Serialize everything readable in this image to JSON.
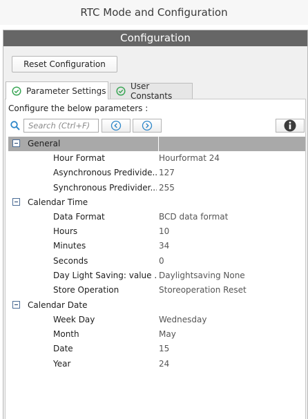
{
  "window": {
    "title": "RTC Mode and Configuration"
  },
  "panel": {
    "header": "Configuration"
  },
  "reset_button": {
    "label": "Reset Configuration"
  },
  "tabs": [
    {
      "label": "Parameter Settings",
      "active": true
    },
    {
      "label": "User Constants",
      "active": false
    }
  ],
  "configure_label": "Configure the below parameters :",
  "search": {
    "placeholder": "Search (Ctrl+F)",
    "value": ""
  },
  "icons": {
    "search": "search-icon",
    "prev": "arrow-left-icon",
    "next": "arrow-right-icon",
    "info": "info-icon",
    "tab_check": "check-circle-icon",
    "collapse": "collapse-icon"
  },
  "colors": {
    "panel_header": "#666666",
    "selected_row": "#a9a9a9",
    "check_green": "#3aa655",
    "nav_blue": "#2c86c9"
  },
  "groups": [
    {
      "label": "General",
      "selected": true,
      "params": [
        {
          "name": "Hour Format",
          "value": "Hourformat 24"
        },
        {
          "name": "Asynchronous Predivide...",
          "value": "127"
        },
        {
          "name": "Synchronous Predivider...",
          "value": "255"
        }
      ]
    },
    {
      "label": "Calendar Time",
      "selected": false,
      "params": [
        {
          "name": "Data Format",
          "value": "BCD data format"
        },
        {
          "name": "Hours",
          "value": "10"
        },
        {
          "name": "Minutes",
          "value": "34"
        },
        {
          "name": "Seconds",
          "value": "0"
        },
        {
          "name": "Day Light Saving: value ...",
          "value": "Daylightsaving None"
        },
        {
          "name": "Store Operation",
          "value": "Storeoperation Reset"
        }
      ]
    },
    {
      "label": "Calendar Date",
      "selected": false,
      "params": [
        {
          "name": "Week Day",
          "value": "Wednesday"
        },
        {
          "name": "Month",
          "value": "May"
        },
        {
          "name": "Date",
          "value": "15"
        },
        {
          "name": "Year",
          "value": "24"
        }
      ]
    }
  ]
}
